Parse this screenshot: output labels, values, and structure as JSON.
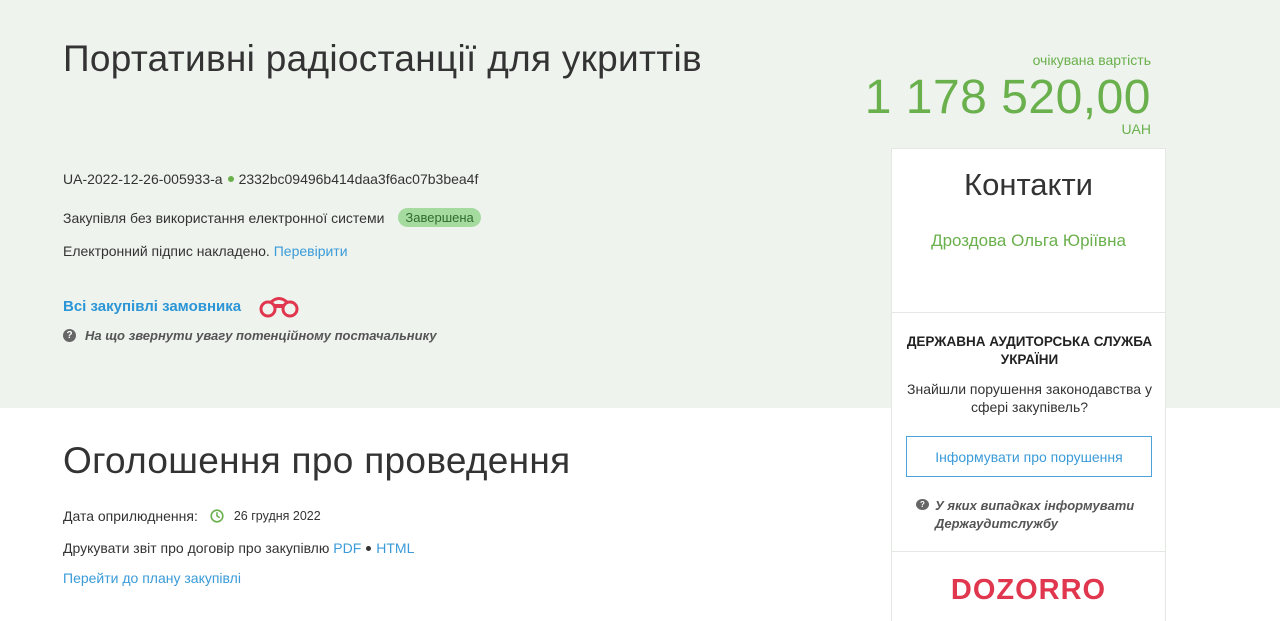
{
  "tender": {
    "title": "Портативні радіостанції для укриттів",
    "id": "UA-2022-12-26-005933-a",
    "hash": "2332bc09496b414daa3f6ac07b3bea4f",
    "procedure_type": "Закупівля без використання електронної системи",
    "status": "Завершена",
    "signature_text": "Електронний підпис накладено.",
    "signature_link": "Перевірити",
    "all_purchases_link": "Всі закупівлі замовника",
    "supplier_hint": "На що звернути увагу потенційному постачальнику"
  },
  "price": {
    "label": "очікувана вартість",
    "value": "1 178 520,00",
    "currency": "UAH"
  },
  "contacts": {
    "title": "Контакти",
    "name": "Дроздова Ольга Юріївна"
  },
  "audit": {
    "title": "ДЕРЖАВНА АУДИТОРСЬКА СЛУЖБА УКРАЇНИ",
    "text": "Знайшли порушення законодавства у сфері закупівель?",
    "button": "Інформувати про порушення",
    "hint": "У яких випадках інформувати Держаудитслужбу"
  },
  "dozorro": {
    "logo_text": "DOZORRO"
  },
  "announcement": {
    "title": "Оголошення про проведення",
    "pub_label": "Дата оприлюднення:",
    "pub_date": "26 грудня 2022",
    "print_label": "Друкувати звіт про договір про закупівлю",
    "pdf": "PDF",
    "html": "HTML",
    "plan_link": "Перейти до плану закупівлі"
  },
  "colors": {
    "accent_green": "#6ab04c",
    "link_blue": "#3a9bd8",
    "dozorro_red": "#e0374f",
    "hero_bg": "#eef3ee"
  }
}
